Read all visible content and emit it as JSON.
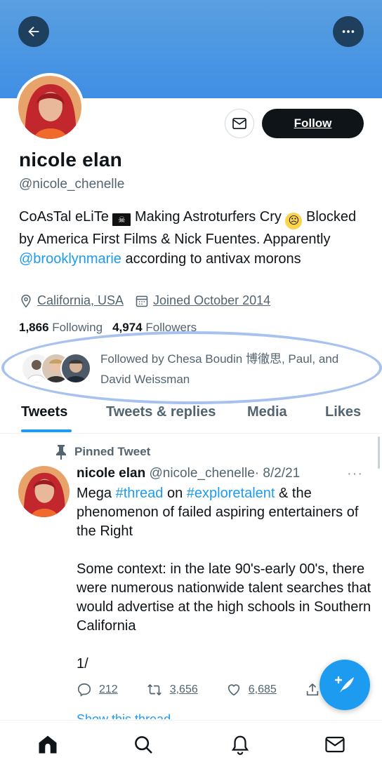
{
  "header": {
    "back_icon": "arrow-left-icon",
    "more_icon": "more-horizontal-icon"
  },
  "profile": {
    "name": "nicole elan",
    "handle": "@nicole_chenelle",
    "follow_label": "Follow",
    "bio": {
      "part1": "CoAsTal eLiTe ",
      "part2": " Making Astroturfers Cry ",
      "part3": " Blocked by America First Films & Nick Fuentes. Apparently ",
      "mention": "@brooklynmarie",
      "part4": " according to antivax morons",
      "emoji_icon": "pirate-flag-icon",
      "emoji2_icon": "crying-face-icon"
    },
    "location": "California, USA",
    "joined": "Joined October 2014",
    "following_count": "1,866",
    "following_label": "Following",
    "followers_count": "4,974",
    "followers_label": "Followers",
    "followed_by": "Followed by Chesa Boudin 博徹思, Paul, and David Weissman"
  },
  "tabs": [
    "Tweets",
    "Tweets & replies",
    "Media",
    "Likes"
  ],
  "tweet": {
    "pinned_label": "Pinned Tweet",
    "author_name": "nicole elan",
    "author_handle": "@nicole_chenelle",
    "date": "· 8/2/21",
    "text_pre": "Mega ",
    "tag1": "#thread",
    "text_mid": " on ",
    "tag2": "#exploretalent",
    "text_post": " & the phenomenon of failed aspiring entertainers of the Right\n\nSome context: in the late 90's-early 00's, there were numerous nationwide talent searches that would advertise at the high schools in Southern California\n\n1/",
    "replies": "212",
    "retweets": "3,656",
    "likes": "6,685",
    "show_thread": "Show this thread"
  },
  "colors": {
    "accent": "#1d9bf0",
    "banner": "#4a95e2",
    "ellipse": "#a7c2ee"
  }
}
